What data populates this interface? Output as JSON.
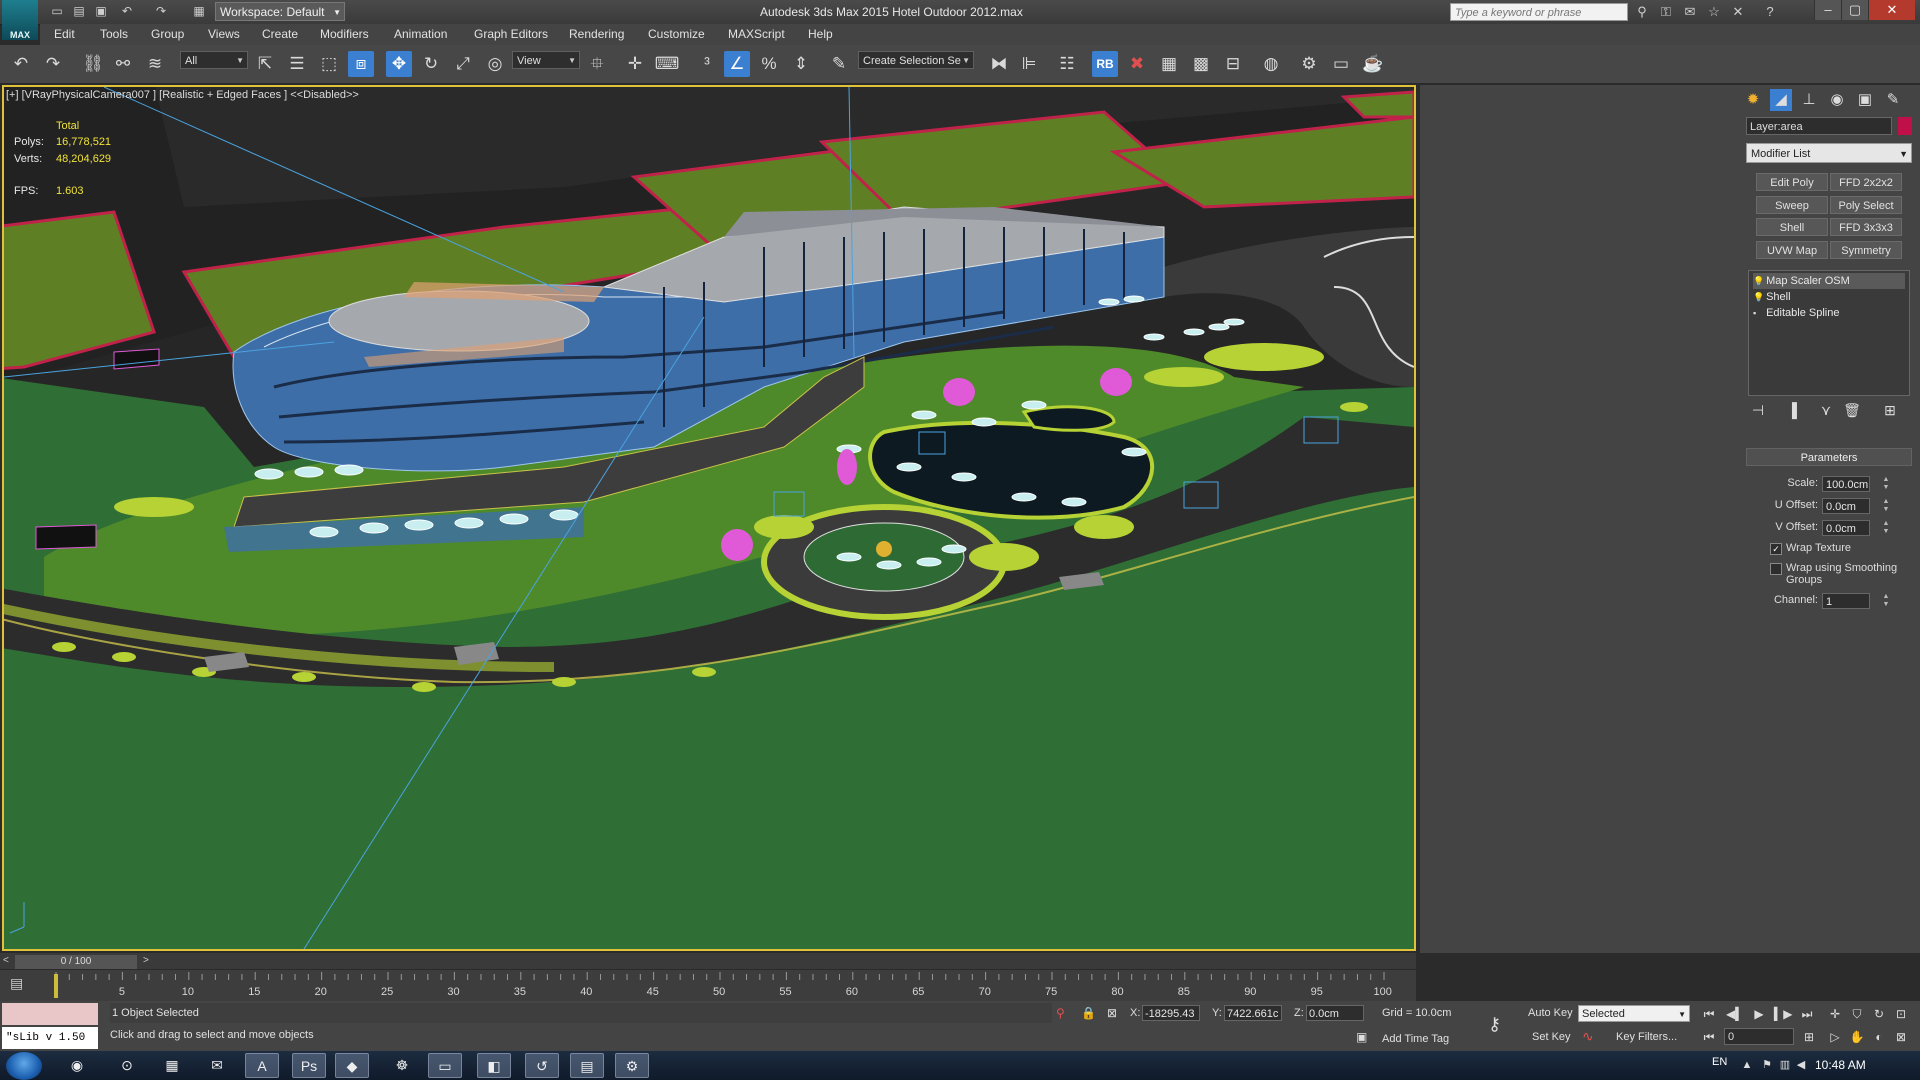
{
  "app": {
    "logo_text": "MAX",
    "window_title": "Autodesk 3ds Max  2015      Hotel Outdoor 2012.max",
    "workspace_label": "Workspace: Default",
    "search_placeholder": "Type a keyword or phrase"
  },
  "menu": [
    "Edit",
    "Tools",
    "Group",
    "Views",
    "Create",
    "Modifiers",
    "Animation",
    "Graph Editors",
    "Rendering",
    "Customize",
    "MAXScript",
    "Help"
  ],
  "toolbar": {
    "selection_filter": "All",
    "reference_coord": "View",
    "named_selection_placeholder": "Create Selection Se",
    "rb_label": "RB"
  },
  "viewport": {
    "label": "[+] [VRayPhysicalCamera007 ] [Realistic + Edged Faces ]  <<Disabled>>",
    "stats_header": "Total",
    "polys_label": "Polys:",
    "polys_value": "16,778,521",
    "verts_label": "Verts:",
    "verts_value": "48,204,629",
    "fps_label": "FPS:",
    "fps_value": "1.603",
    "colors": {
      "ground": "#2f6e34",
      "lawn": "#5a8a2a",
      "road": "#2b2b2b",
      "glass": "#3d6ea8",
      "roof": "#a5a9ae",
      "pool": "#0d1a22",
      "shrub": "#b6d234",
      "magenta": "#e05ad8",
      "viewport_border": "#e0c23a"
    }
  },
  "command_panel": {
    "layer_name": "Layer:area",
    "modifier_list": "Modifier List",
    "modifier_buttons": [
      "Edit Poly",
      "FFD 2x2x2",
      "Sweep",
      "Poly Select",
      "Shell",
      "FFD 3x3x3",
      "UVW Map",
      "Symmetry"
    ],
    "stack": [
      "Map Scaler OSM",
      "Shell",
      "Editable Spline"
    ],
    "parameters_title": "Parameters",
    "scale_label": "Scale:",
    "scale_value": "100.0cm",
    "u_offset_label": "U Offset:",
    "u_offset_value": "0.0cm",
    "v_offset_label": "V Offset:",
    "v_offset_value": "0.0cm",
    "wrap_texture_label": "Wrap Texture",
    "wrap_smoothing_label": "Wrap using Smoothing Groups",
    "channel_label": "Channel:",
    "channel_value": "1"
  },
  "timeline": {
    "frame_counter": "0 / 100",
    "ticks": [
      "5",
      "10",
      "15",
      "20",
      "25",
      "30",
      "35",
      "40",
      "45",
      "50",
      "55",
      "60",
      "65",
      "70",
      "75",
      "80",
      "85",
      "90",
      "95",
      "100"
    ]
  },
  "status": {
    "maxscript_text": "\"sLib v 1.50",
    "selection_text": "1 Object Selected",
    "prompt_text": "Click and drag to select and move objects",
    "x_label": "X:",
    "x_value": "-18295.43",
    "y_label": "Y:",
    "y_value": "7422.661c",
    "z_label": "Z:",
    "z_value": "0.0cm",
    "grid_text": "Grid = 10.0cm",
    "add_time_tag": "Add Time Tag",
    "auto_key": "Auto Key",
    "set_key": "Set Key",
    "selected_drop": "Selected",
    "key_filters": "Key Filters...",
    "frame_value": "0"
  },
  "taskbar": {
    "lang": "EN",
    "clock": "10:48 AM"
  }
}
